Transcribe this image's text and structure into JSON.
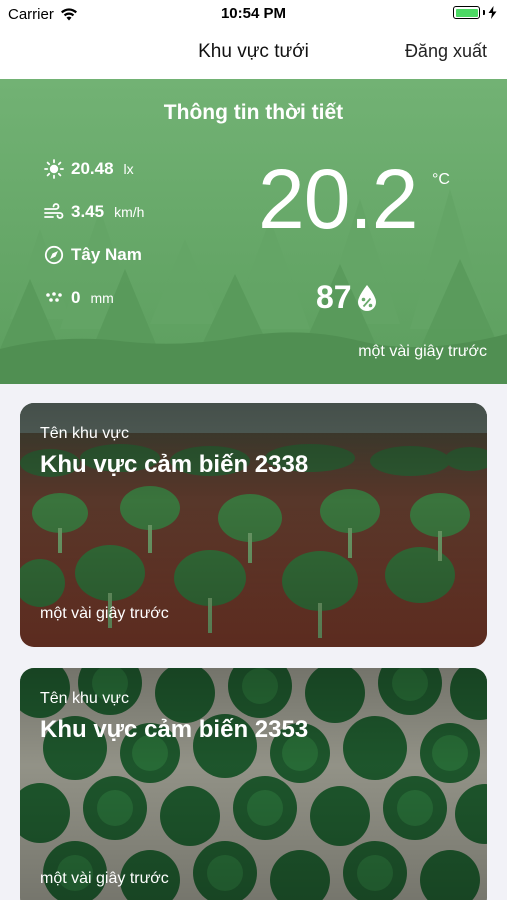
{
  "status_bar": {
    "carrier": "Carrier",
    "time": "10:54 PM"
  },
  "nav": {
    "title": "Khu vực tưới",
    "logout_label": "Đăng xuất"
  },
  "weather": {
    "title": "Thông tin thời tiết",
    "light": {
      "value": "20.48",
      "unit": "lx",
      "icon": "sun-icon"
    },
    "wind_speed": {
      "value": "3.45",
      "unit": "km/h",
      "icon": "wind-icon"
    },
    "wind_direction": {
      "value": "Tây Nam",
      "icon": "compass-icon"
    },
    "rain": {
      "value": "0",
      "unit": "mm",
      "icon": "rain-icon"
    },
    "temperature": "20.2",
    "temperature_unit": "°C",
    "humidity": "87",
    "humidity_icon": "humidity-percent-icon",
    "updated": "một vài giây trước",
    "bg_color": "#6aaa6c"
  },
  "zones": [
    {
      "label": "Tên khu vực",
      "name": "Khu vực cảm biến 2338",
      "updated": "một vài giây trước"
    },
    {
      "label": "Tên khu vực",
      "name": "Khu vực cảm biến 2353",
      "updated": "một vài giây trước"
    }
  ]
}
